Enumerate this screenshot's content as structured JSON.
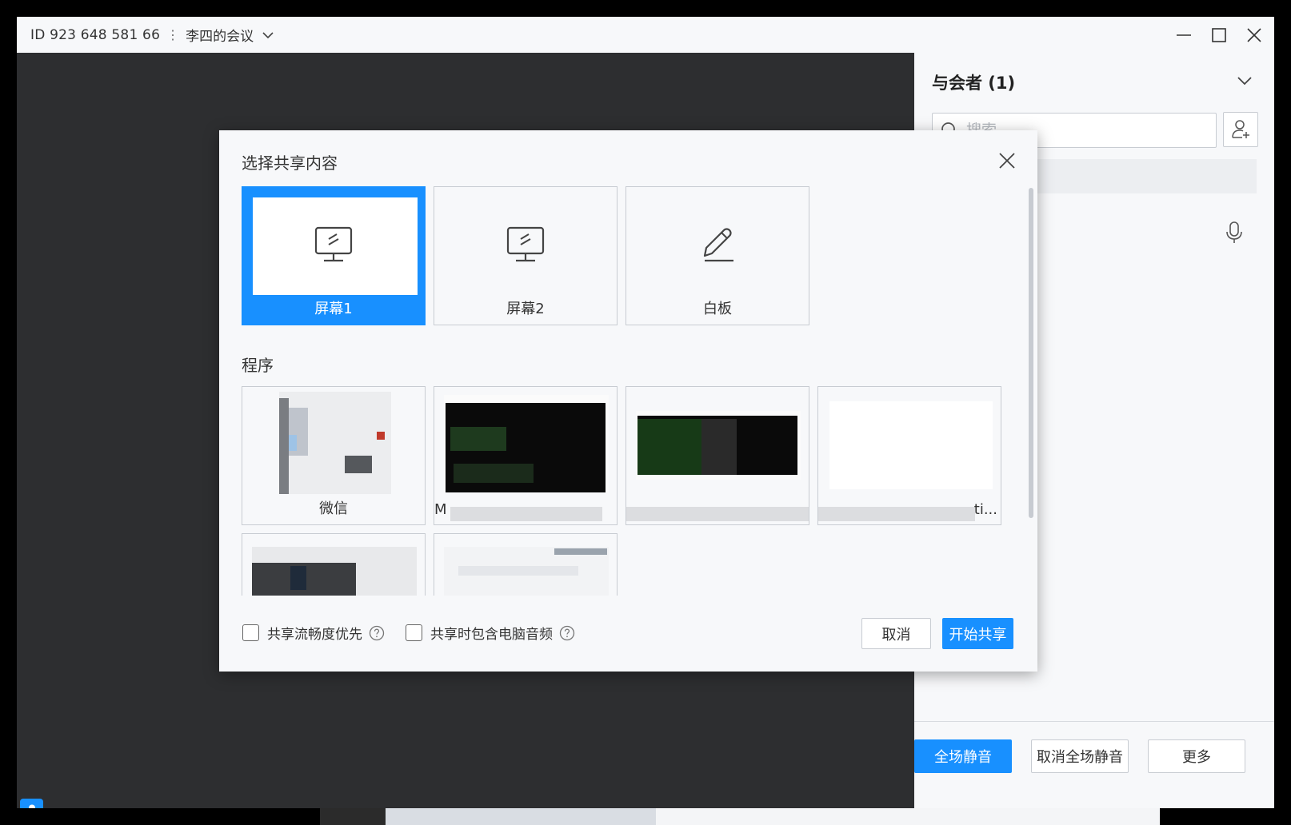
{
  "titlebar": {
    "meeting_id": "ID 923 648 581 66",
    "separator": "⋮",
    "meeting_name": "李四的会议",
    "icons": [
      "chevron-down-icon",
      "minimize-icon",
      "maximize-icon",
      "close-icon"
    ]
  },
  "panel": {
    "header": "与会者 (1)",
    "search_placeholder": "搜索",
    "footer": {
      "mute_all": "全场静音",
      "unmute_all": "取消全场静音",
      "more": "更多"
    }
  },
  "dialog": {
    "title": "选择共享内容",
    "screens": [
      {
        "label": "屏幕1",
        "selected": true,
        "icon": "monitor-icon"
      },
      {
        "label": "屏幕2",
        "selected": false,
        "icon": "monitor-icon"
      },
      {
        "label": "白板",
        "selected": false,
        "icon": "pen-icon"
      }
    ],
    "programs_label": "程序",
    "programs": [
      {
        "label": "微信"
      },
      {
        "label": "M"
      },
      {
        "label": ""
      },
      {
        "label": "ti..."
      },
      {
        "label": ""
      },
      {
        "label": ""
      }
    ],
    "options": {
      "fluency_first": "共享流畅度优先",
      "include_audio": "共享时包含电脑音频"
    },
    "cancel": "取消",
    "start": "开始共享"
  },
  "colors": {
    "accent": "#1890ff",
    "panel_bg": "#f7f8fa",
    "video_bg": "#2d2e30"
  }
}
